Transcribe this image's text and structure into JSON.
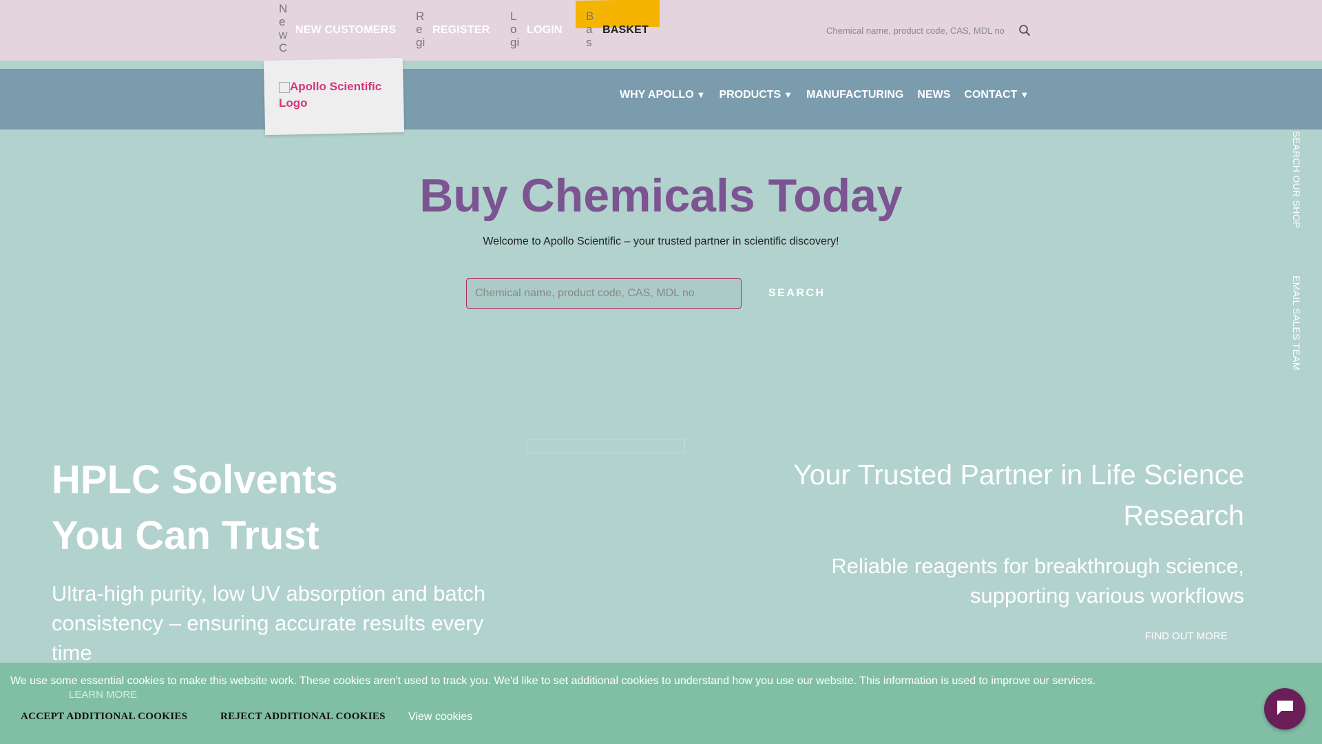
{
  "colors": {
    "topbar": "#e3d4de",
    "navbar": "#7b9cad",
    "page_bg": "#b2d2cd",
    "title_purple": "#7b5491",
    "basket_yellow": "#f4b400",
    "cookie_bg": "#81bfa5",
    "chat_button": "#6b1f59",
    "logo_pink": "#d4357a"
  },
  "utility": {
    "new_customers": {
      "icon_alt": "New Customers icon",
      "label": "NEW CUSTOMERS"
    },
    "register": {
      "icon_alt": "Register icon",
      "label": "REGISTER"
    },
    "login": {
      "icon_alt": "Login icon",
      "label": "LOGIN"
    },
    "basket": {
      "icon_alt": "Basket icon",
      "label": "BASKET"
    }
  },
  "top_search": {
    "placeholder": "Chemical name, product code, CAS, MDL no",
    "icon": "search-icon"
  },
  "logo": {
    "alt": "Apollo Scientific Logo"
  },
  "nav": {
    "items": [
      {
        "label": "WHY APOLLO",
        "caret": "▼"
      },
      {
        "label": "PRODUCTS",
        "caret": "▼"
      },
      {
        "label": "MANUFACTURING"
      },
      {
        "label": "NEWS"
      },
      {
        "label": "CONTACT",
        "caret": "▼"
      }
    ]
  },
  "hero": {
    "title": "Buy Chemicals Today",
    "subtitle": "Welcome to Apollo Scientific – your trusted partner in scientific discovery!",
    "search_placeholder": "Chemical name, product code, CAS, MDL no",
    "search_button": "SEARCH"
  },
  "side_links": {
    "search_shop": "SEARCH OUR SHOP",
    "email_sales": "EMAIL SALES TEAM"
  },
  "banner": {
    "left_title_line1": "HPLC Solvents",
    "left_title_line2": "You Can Trust",
    "left_text": "Ultra-high purity, low UV absorption and batch consistency – ensuring accurate results every time",
    "right_title": "Your Trusted Partner in Life Science Research",
    "right_text": "Reliable reagents for breakthrough science, supporting various workflows",
    "find_out_more": "FIND OUT MORE"
  },
  "cookie": {
    "text": "We use some essential cookies to make this website work. These cookies aren't used to track you. We'd like to set additional cookies to understand how you use our website. This information is used to improve our services.",
    "learn_more": "LEARN MORE",
    "accept": "ACCEPT ADDITIONAL COOKIES",
    "reject": "REJECT ADDITIONAL COOKIES",
    "view": "View cookies"
  },
  "chat": {
    "icon": "chat-icon"
  }
}
